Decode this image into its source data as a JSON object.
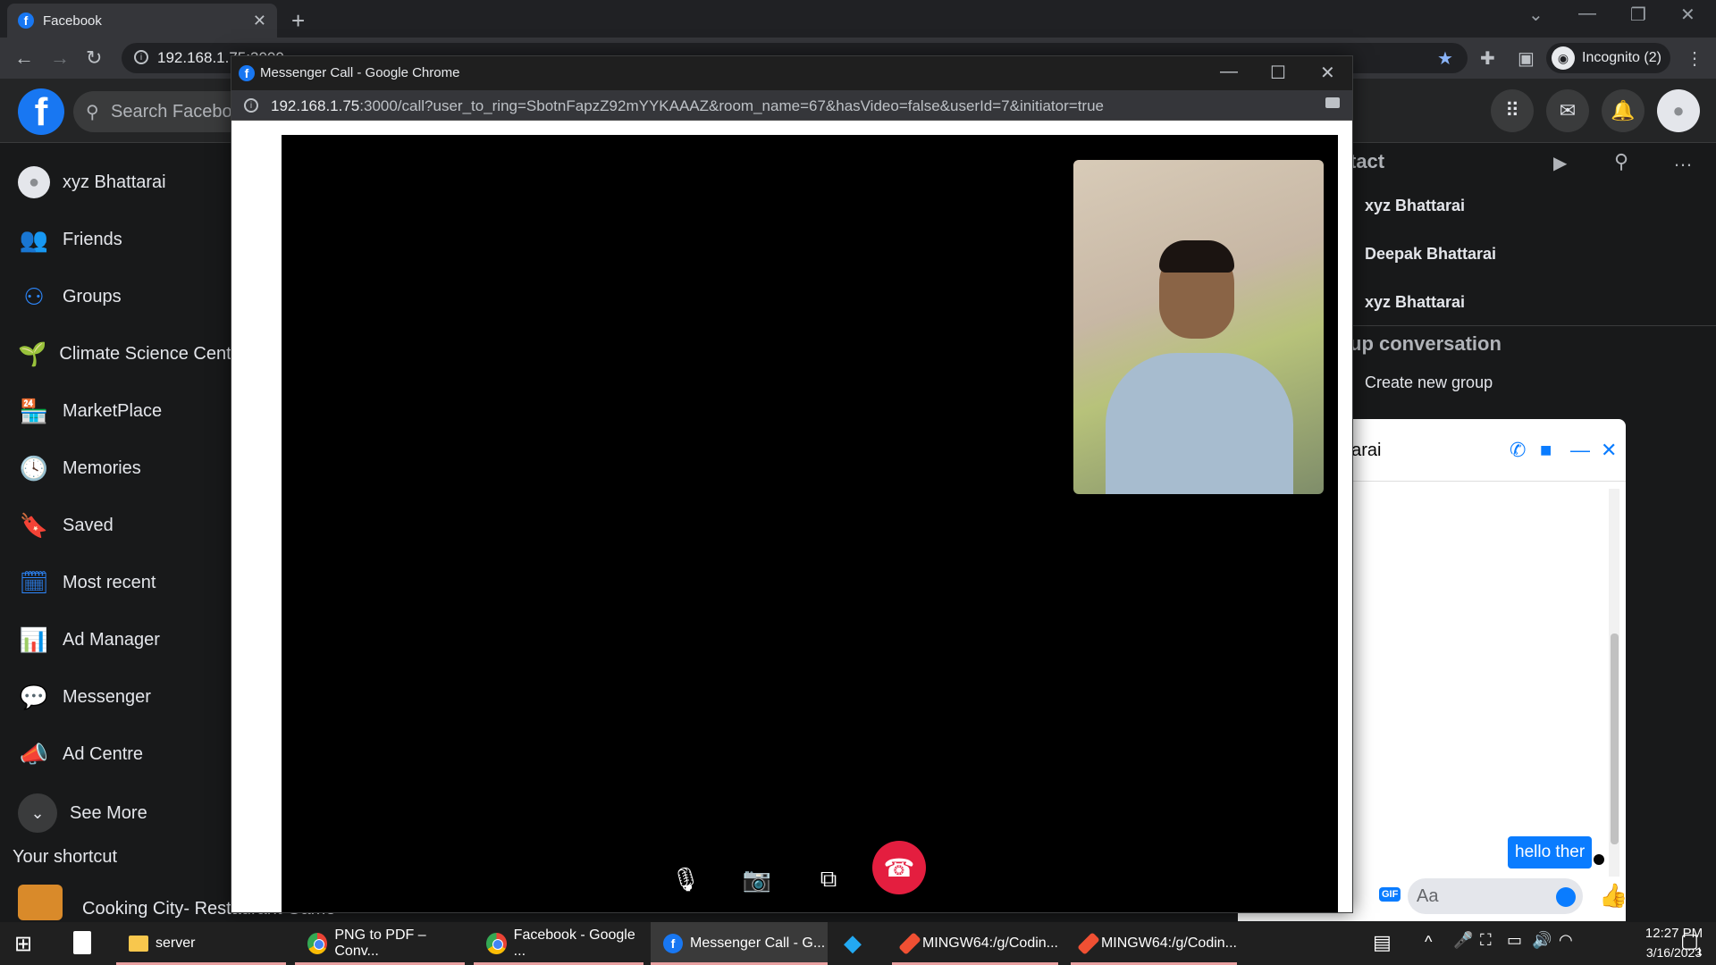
{
  "browser": {
    "tab_title": "Facebook",
    "tab_icon": "facebook-icon",
    "url_partial": "192.168.1.75:3000",
    "profile_label": "Incognito (2)"
  },
  "facebook": {
    "search_placeholder": "Search Facebook",
    "sidebar": [
      {
        "label": "xyz Bhattarai",
        "icon": "avatar-icon"
      },
      {
        "label": "Friends",
        "icon": "friends-icon"
      },
      {
        "label": "Groups",
        "icon": "groups-icon"
      },
      {
        "label": "Climate Science Center",
        "icon": "climate-icon"
      },
      {
        "label": "MarketPlace",
        "icon": "marketplace-icon"
      },
      {
        "label": "Memories",
        "icon": "memories-icon"
      },
      {
        "label": "Saved",
        "icon": "saved-icon"
      },
      {
        "label": "Most recent",
        "icon": "recent-icon"
      },
      {
        "label": "Ad Manager",
        "icon": "ad-manager-icon"
      },
      {
        "label": "Messenger",
        "icon": "messenger-icon"
      },
      {
        "label": "Ad Centre",
        "icon": "ad-centre-icon"
      },
      {
        "label": "See More",
        "icon": "chevron-down-icon"
      }
    ],
    "shortcut_title": "Your shortcut",
    "shortcut_item": "Cooking City- Restaurant Game",
    "contacts_title": "tact",
    "contacts": [
      "xyz Bhattarai",
      "Deepak Bhattarai",
      "xyz Bhattarai"
    ],
    "group_title": "up conversation",
    "create_group": "Create new group"
  },
  "chat": {
    "name": "ttarai",
    "message": "hello ther",
    "input_placeholder": "Aa",
    "gif_label": "GIF"
  },
  "popup": {
    "title": "Messenger Call - Google Chrome",
    "url_host": "192.168.1.75",
    "url_rest": ":3000/call?user_to_ring=SbotnFapzZ92mYYKAAAZ&room_name=67&hasVideo=false&userId=7&initiator=true"
  },
  "taskbar": {
    "apps": [
      {
        "label": "server",
        "icon": "folder-icon"
      },
      {
        "label": "PNG to PDF – Conv...",
        "icon": "chrome-icon"
      },
      {
        "label": "Facebook - Google ...",
        "icon": "chrome-icon"
      },
      {
        "label": "Messenger Call - G...",
        "icon": "facebook-icon"
      },
      {
        "label": "MINGW64:/g/Codin...",
        "icon": "git-icon"
      },
      {
        "label": "MINGW64:/g/Codin...",
        "icon": "git-icon"
      }
    ],
    "time": "12:27 PM",
    "date": "3/16/2023",
    "notification_count": "1"
  },
  "colors": {
    "facebook_blue": "#1877f2",
    "end_call_red": "#e41e3f",
    "messenger_blue": "#0a7cff"
  }
}
